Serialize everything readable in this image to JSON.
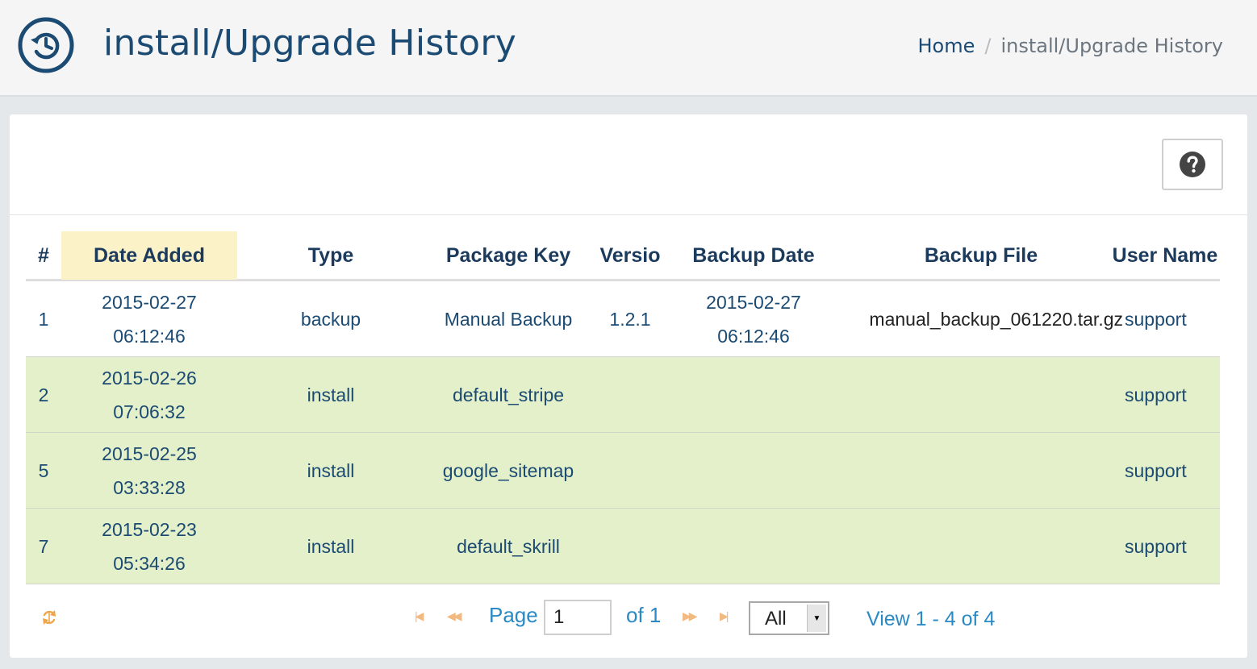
{
  "header": {
    "title": "install/Upgrade History",
    "icon": "history-icon"
  },
  "breadcrumb": {
    "home": "Home",
    "separator": "/",
    "current": "install/Upgrade History"
  },
  "toolbar": {
    "help_icon": "question-circle-icon"
  },
  "table": {
    "columns": [
      "#",
      "Date Added",
      "Type",
      "Package Key",
      "Versio",
      "Backup Date",
      "Backup File",
      "User Name"
    ],
    "sorted_column": "Date Added",
    "rows": [
      {
        "num": "1",
        "date": "2015-02-27",
        "time": "06:12:46",
        "type": "backup",
        "package": "Manual Backup",
        "version": "1.2.1",
        "backup_date": "2015-02-27",
        "backup_time": "06:12:46",
        "backup_file": "manual_backup_061220.tar.gz",
        "user": "support"
      },
      {
        "num": "2",
        "date": "2015-02-26",
        "time": "07:06:32",
        "type": "install",
        "package": "default_stripe",
        "version": "",
        "backup_date": "",
        "backup_time": "",
        "backup_file": "",
        "user": "support"
      },
      {
        "num": "5",
        "date": "2015-02-25",
        "time": "03:33:28",
        "type": "install",
        "package": "google_sitemap",
        "version": "",
        "backup_date": "",
        "backup_time": "",
        "backup_file": "",
        "user": "support"
      },
      {
        "num": "7",
        "date": "2015-02-23",
        "time": "05:34:26",
        "type": "install",
        "package": "default_skrill",
        "version": "",
        "backup_date": "",
        "backup_time": "",
        "backup_file": "",
        "user": "support"
      }
    ]
  },
  "pager": {
    "refresh_icon": "refresh-icon",
    "page_label": "Page",
    "page_value": "1",
    "of_label": "of 1",
    "rows_option": "All",
    "view_info": "View 1 - 4 of 4",
    "colors": {
      "link": "#2a8ac6",
      "nav": "#f2b980",
      "row_highlight": "#e3f0c9",
      "sorted_header": "#fcf2c8"
    }
  }
}
